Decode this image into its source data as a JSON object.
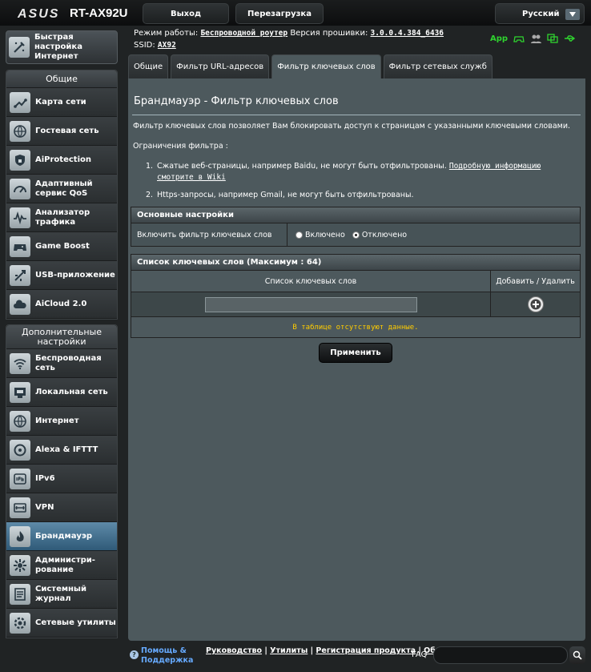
{
  "header": {
    "brand": "ASUS",
    "model": "RT-AX92U",
    "logout_label": "Выход",
    "reboot_label": "Перезагрузка",
    "language": "Русский"
  },
  "info": {
    "mode_label": "Режим работы:",
    "mode_value": "Беспроводной роутер",
    "firmware_label": "Версия прошивки:",
    "firmware_value": "3.0.0.4.384_6436",
    "ssid_label": "SSID:",
    "ssid_value": "AX92",
    "app_label": "App"
  },
  "sidebar": {
    "quick_setup": "Быстрая настройка Интернет",
    "general_title": "Общие",
    "general_items": [
      {
        "label": "Карта сети",
        "icon": "network-map-icon"
      },
      {
        "label": "Гостевая сеть",
        "icon": "globe-icon"
      },
      {
        "label": "AiProtection",
        "icon": "shield-lock-icon"
      },
      {
        "label": "Адаптивный сервис QoS",
        "icon": "speedometer-icon"
      },
      {
        "label": "Анализатор трафика",
        "icon": "waveform-icon"
      },
      {
        "label": "Game Boost",
        "icon": "gamepad-icon"
      },
      {
        "label": "USB-приложение",
        "icon": "usb-icon"
      },
      {
        "label": "AiCloud 2.0",
        "icon": "cloud-icon"
      }
    ],
    "advanced_title": "Дополнительные настройки",
    "advanced_items": [
      {
        "label": "Беспроводная сеть",
        "icon": "wifi-icon"
      },
      {
        "label": "Локальная сеть",
        "icon": "lan-icon"
      },
      {
        "label": "Интернет",
        "icon": "globe-icon"
      },
      {
        "label": "Alexa & IFTTT",
        "icon": "alexa-icon"
      },
      {
        "label": "IPv6",
        "icon": "ipv6-icon"
      },
      {
        "label": "VPN",
        "icon": "vpn-icon"
      },
      {
        "label": "Брандмауэр",
        "icon": "firewall-icon",
        "active": true
      },
      {
        "label": "Администри-рование",
        "icon": "admin-icon"
      },
      {
        "label": "Системный журнал",
        "icon": "log-icon"
      },
      {
        "label": "Сетевые утилиты",
        "icon": "tools-icon"
      }
    ]
  },
  "tabs": [
    "Общие",
    "Фильтр URL-адресов",
    "Фильтр ключевых слов",
    "Фильтр сетевых служб"
  ],
  "active_tab": 2,
  "content": {
    "title": "Брандмауэр - Фильтр ключевых слов",
    "description": "Фильтр ключевых слов позволяет Вам блокировать доступ к страницам с указанными ключевыми словами.",
    "limits_title": "Ограничения фильтра :",
    "note1_num": "1.",
    "note1_text": "Сжатые веб-страницы, например Baidu, не могут быть отфильтрованы.",
    "note1_link": "Подробную информацию смотрите в Wiki",
    "note2_num": "2.",
    "note2_text": "Https-запросы, например Gmail, не могут быть отфильтрованы.",
    "basic_header": "Основные настройки",
    "enable_label": "Включить фильтр ключевых слов",
    "radio_on": "Включено",
    "radio_off": "Отключено",
    "radio_selected": "off",
    "list_header": "Список ключевых слов (Максимум : 64)",
    "col_keywords": "Список ключевых слов",
    "col_add_delete": "Добавить / Удалить",
    "keyword_value": "",
    "empty_message": "В таблице отсутствуют данные.",
    "apply_label": "Применить"
  },
  "footer": {
    "help": "Помощь & Поддержка",
    "link_manual": "Руководство",
    "link_utilities": "Утилиты",
    "link_registration": "Регистрация продукта",
    "link_feedback": "Обратная связь",
    "faq": "FAQ",
    "faq_value": ""
  },
  "colors": {
    "accent": "#2fd32f",
    "active_item": "#4a7a9a",
    "warning": "#ffcc00",
    "panel": "#4d595d"
  }
}
